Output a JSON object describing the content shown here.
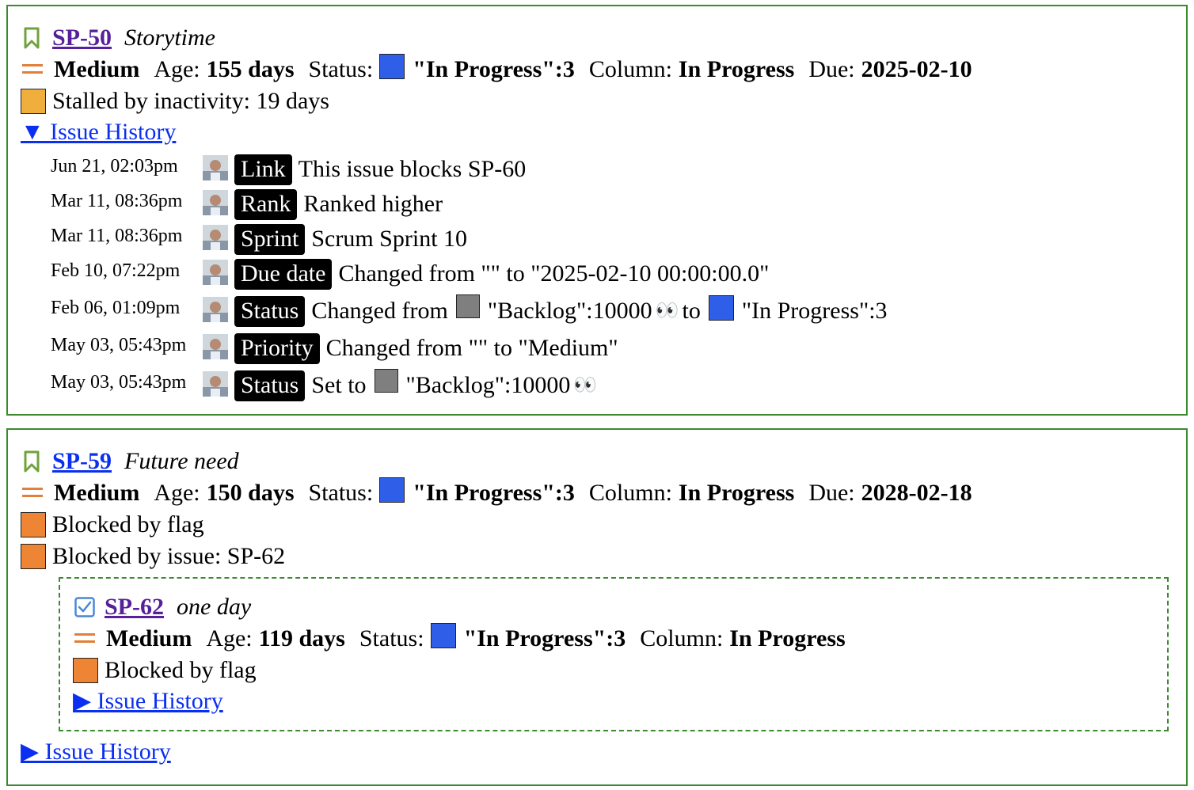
{
  "colors": {
    "card_border": "#3c8a2e",
    "link_visited": "#55209a",
    "link": "#0b2ff0",
    "status_in_progress": "#2f5fe8",
    "status_backlog": "#7f7f7f",
    "stalled": "#f0ae3c",
    "blocked": "#ee8535",
    "priority_medium": "#e1803a"
  },
  "issues": [
    {
      "key": "SP-50",
      "summary": "Storytime",
      "icon": "bookmark-icon",
      "priority": "Medium",
      "age_label": "Age:",
      "age": "155 days",
      "status_label": "Status:",
      "status": "\"In Progress\":3",
      "column_label": "Column:",
      "column": "In Progress",
      "due_label": "Due:",
      "due": "2025-02-10",
      "warnings": [
        "Stalled by inactivity: 19 days"
      ],
      "history_toggle": "▼ Issue History",
      "history": [
        {
          "date": "Jun 21, 02:03pm",
          "tag": "Link",
          "text": "This issue blocks SP-60"
        },
        {
          "date": "Mar 11, 08:36pm",
          "tag": "Rank",
          "text": "Ranked higher"
        },
        {
          "date": "Mar 11, 08:36pm",
          "tag": "Sprint",
          "text": "Scrum Sprint 10"
        },
        {
          "date": "Feb 10, 07:22pm",
          "tag": "Due date",
          "text": "Changed from \"\" to \"2025-02-10 00:00:00.0\""
        },
        {
          "date": "Feb 06, 01:09pm",
          "tag": "Status",
          "prefix": "Changed from",
          "from": "\"Backlog\":10000",
          "eyes": "👀",
          "mid": "to",
          "to": "\"In Progress\":3"
        },
        {
          "date": "May 03, 05:43pm",
          "tag": "Priority",
          "text": "Changed from \"\" to \"Medium\""
        },
        {
          "date": "May 03, 05:43pm",
          "tag": "Status",
          "prefix": "Set to",
          "from": "\"Backlog\":10000",
          "eyes": "👀"
        }
      ]
    },
    {
      "key": "SP-59",
      "summary": "Future need",
      "icon": "bookmark-icon",
      "priority": "Medium",
      "age_label": "Age:",
      "age": "150 days",
      "status_label": "Status:",
      "status": "\"In Progress\":3",
      "column_label": "Column:",
      "column": "In Progress",
      "due_label": "Due:",
      "due": "2028-02-18",
      "warnings": [
        "Blocked by flag",
        "Blocked by issue: SP-62"
      ],
      "history_toggle": "▶ Issue History",
      "blocker": {
        "key": "SP-62",
        "summary": "one day",
        "icon": "checkbox-icon",
        "priority": "Medium",
        "age_label": "Age:",
        "age": "119 days",
        "status_label": "Status:",
        "status": "\"In Progress\":3",
        "column_label": "Column:",
        "column": "In Progress",
        "warnings": [
          "Blocked by flag"
        ],
        "history_toggle": "▶ Issue History"
      }
    }
  ]
}
